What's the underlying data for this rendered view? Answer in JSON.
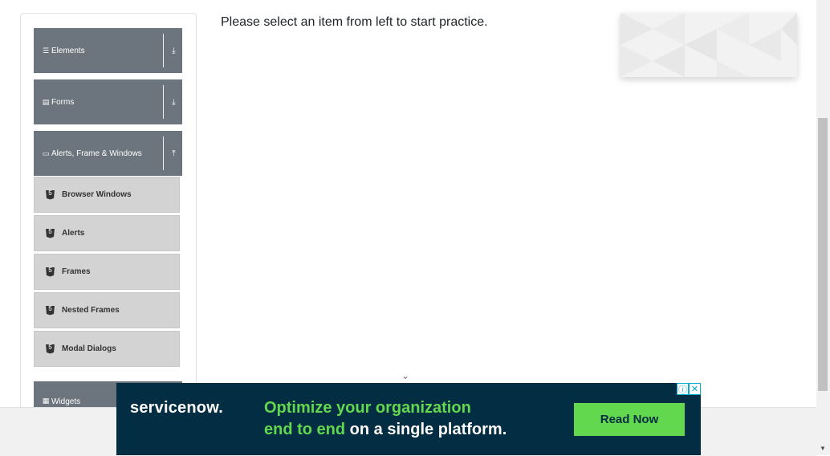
{
  "sidebar": {
    "groups": [
      {
        "label": "Elements",
        "icon": "hamburger-icon",
        "state": "collapsed"
      },
      {
        "label": "Forms",
        "icon": "form-icon",
        "state": "collapsed"
      },
      {
        "label": "Alerts, Frame & Windows",
        "icon": "window-icon",
        "state": "expanded"
      },
      {
        "label": "Widgets",
        "icon": "grid-icon",
        "state": "collapsed"
      }
    ],
    "items": [
      {
        "label": "Browser Windows",
        "icon": "html5-icon"
      },
      {
        "label": "Alerts",
        "icon": "html5-icon"
      },
      {
        "label": "Frames",
        "icon": "html5-icon"
      },
      {
        "label": "Nested Frames",
        "icon": "html5-icon"
      },
      {
        "label": "Modal Dialogs",
        "icon": "html5-icon"
      }
    ]
  },
  "main": {
    "instruction": "Please select an item from left to start practice."
  },
  "ad": {
    "logo_text": "servicenow.",
    "headline_highlight_1": "Optimize your organization",
    "headline_highlight_2": "end to end",
    "headline_rest": "on a single platform.",
    "cta_label": "Read Now",
    "colors": {
      "background": "#032d42",
      "accent": "#62d84e"
    }
  }
}
